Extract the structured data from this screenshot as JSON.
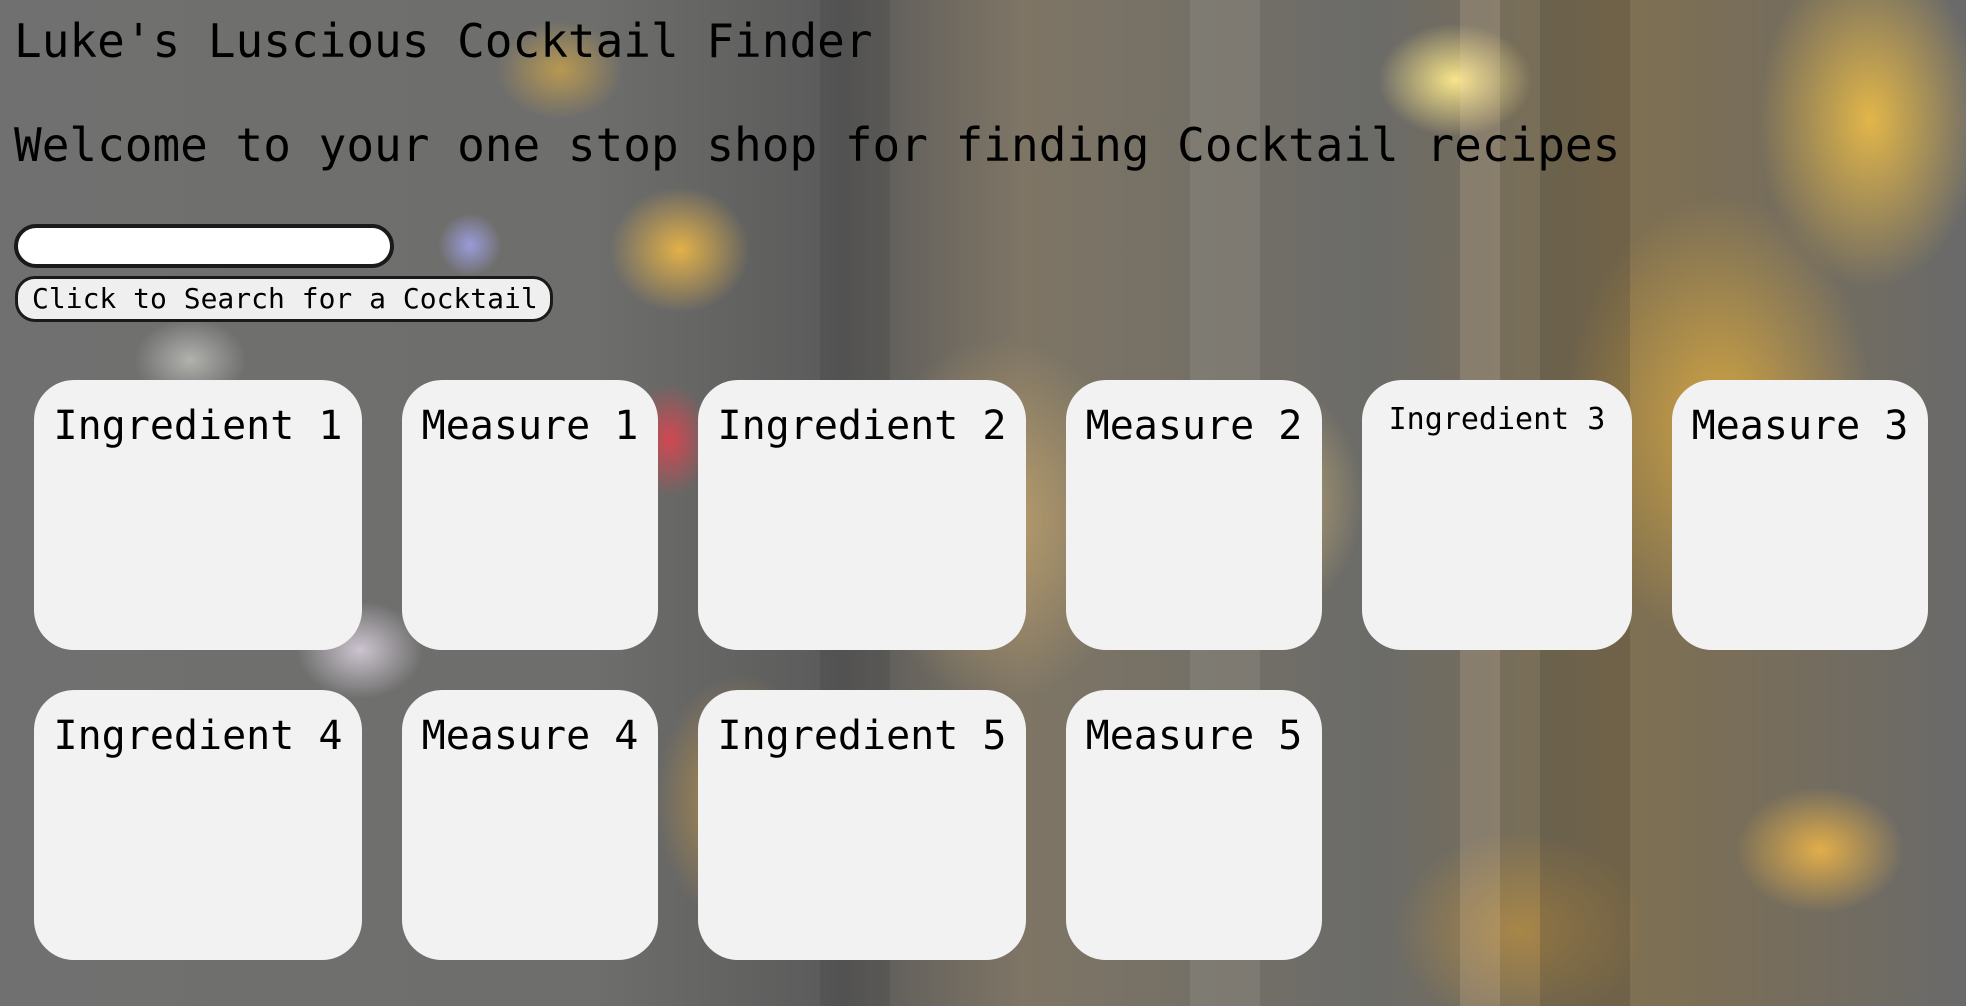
{
  "page": {
    "title": "Luke's Luscious Cocktail Finder",
    "subtitle": "Welcome to your one stop shop for finding Cocktail recipes"
  },
  "search": {
    "value": "",
    "placeholder": "",
    "button_label": "Click to Search for a Cocktail"
  },
  "cards": {
    "ingredient1": {
      "label": "Ingredient 1",
      "value": ""
    },
    "measure1": {
      "label": "Measure 1",
      "value": ""
    },
    "ingredient2": {
      "label": "Ingredient 2",
      "value": ""
    },
    "measure2": {
      "label": "Measure 2",
      "value": ""
    },
    "ingredient3": {
      "label": "Ingredient 3",
      "value": ""
    },
    "measure3": {
      "label": "Measure 3",
      "value": ""
    },
    "ingredient4": {
      "label": "Ingredient 4",
      "value": ""
    },
    "measure4": {
      "label": "Measure 4",
      "value": ""
    },
    "ingredient5": {
      "label": "Ingredient 5",
      "value": ""
    },
    "measure5": {
      "label": "Measure 5",
      "value": ""
    }
  },
  "colors": {
    "card_background": "#f2f2f2",
    "input_border": "#1a1a1a",
    "button_background": "#efefef"
  }
}
